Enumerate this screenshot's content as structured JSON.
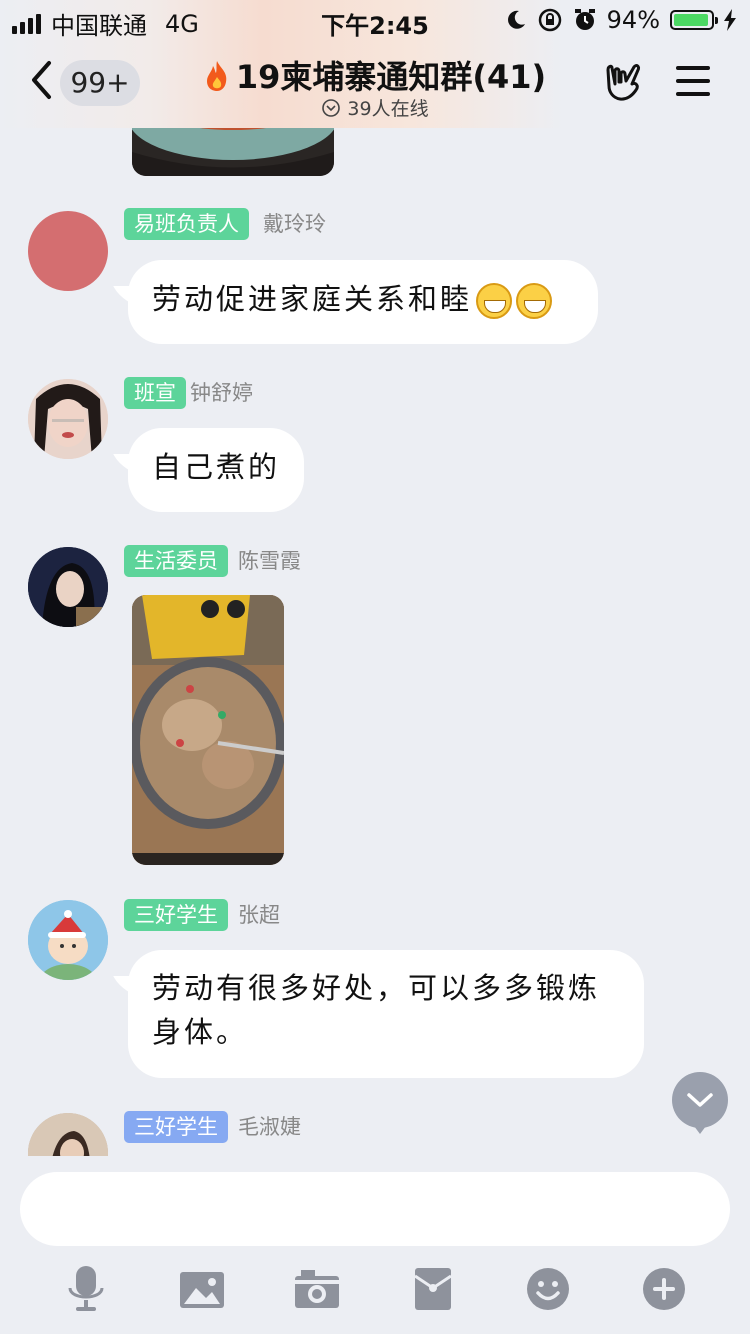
{
  "status_bar": {
    "carrier": "中国联通",
    "network": "4G",
    "time": "下午2:45",
    "battery_percent": "94%",
    "battery_level": 0.94
  },
  "header": {
    "back_label": "<",
    "unread_count": "99+",
    "group_name": "19柬埔寨通知群(41)",
    "online_count": "39人在线",
    "icons": [
      "fire-icon",
      "hand-gesture-icon",
      "menu-icon",
      "online-chevron-icon"
    ]
  },
  "messages": [
    {
      "role": "易班负责人",
      "sender": "戴玲玲",
      "badge_color": "#5dd49a",
      "text": "劳动促进家庭关系和睦",
      "emoji": [
        "grinning-face-icon",
        "grinning-face-icon"
      ]
    },
    {
      "role": "班宣",
      "sender": "钟舒婷",
      "badge_color": "#5dd49a",
      "text": "自己煮的"
    },
    {
      "role": "生活委员",
      "sender": "陈雪霞",
      "badge_color": "#5dd49a",
      "content": "food-photo"
    },
    {
      "role": "三好学生",
      "sender": "张超",
      "badge_color": "#5dd49a",
      "text": "劳动有很多好处，可以多多锻炼身体。"
    },
    {
      "role": "三好学生",
      "sender": "毛淑婕",
      "badge_color": "#86a9f2"
    }
  ],
  "input": {
    "placeholder": ""
  },
  "toolbar": [
    "microphone-icon",
    "image-icon",
    "camera-icon",
    "red-packet-icon",
    "emoji-icon",
    "plus-icon"
  ],
  "colors": {
    "background": "#eceef3",
    "badge_green": "#5dd49a",
    "badge_blue": "#86a9f2",
    "toolbar_icon": "#8e929c",
    "battery": "#4cd964"
  }
}
